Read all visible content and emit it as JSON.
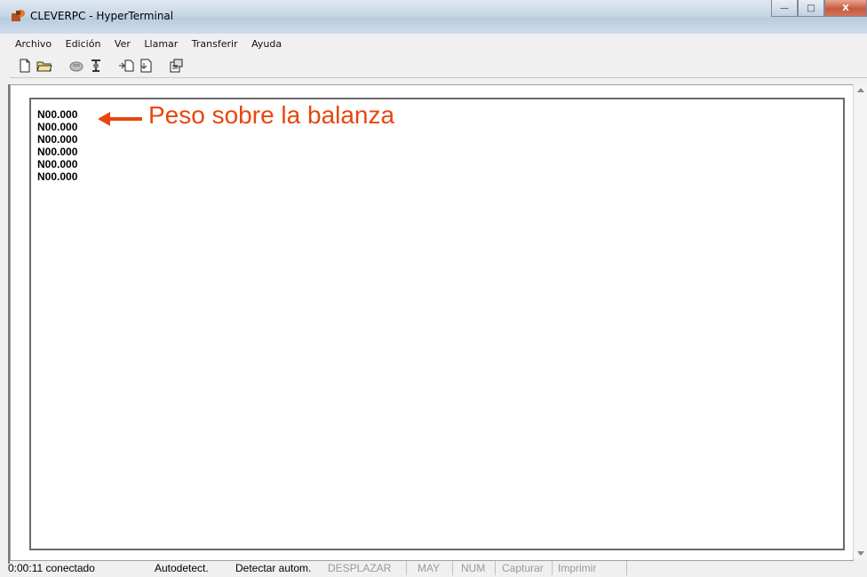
{
  "window": {
    "title": "CLEVERPC - HyperTerminal",
    "buttons": {
      "minimize": "—",
      "maximize": "□",
      "close": "X"
    }
  },
  "menu": [
    "Archivo",
    "Edición",
    "Ver",
    "Llamar",
    "Transferir",
    "Ayuda"
  ],
  "toolbar": {
    "icons": [
      "new-connection-icon",
      "open-icon",
      "call-icon",
      "disconnect-icon",
      "send-icon",
      "receive-icon",
      "properties-icon"
    ]
  },
  "terminal": {
    "lines": [
      "N00.000",
      "N00.000",
      "N00.000",
      "N00.000",
      "N00.000",
      "N00.000"
    ],
    "annotation": "Peso sobre la balanza",
    "annotation_color": "#e8460e"
  },
  "status": {
    "connection": "0:00:11 conectado",
    "autodetect": "Autodetect.",
    "detect": "Detectar autom.",
    "scroll": "DESPLAZAR",
    "caps": "MAY",
    "num": "NUM",
    "capture": "Capturar",
    "print": "Imprimir"
  }
}
